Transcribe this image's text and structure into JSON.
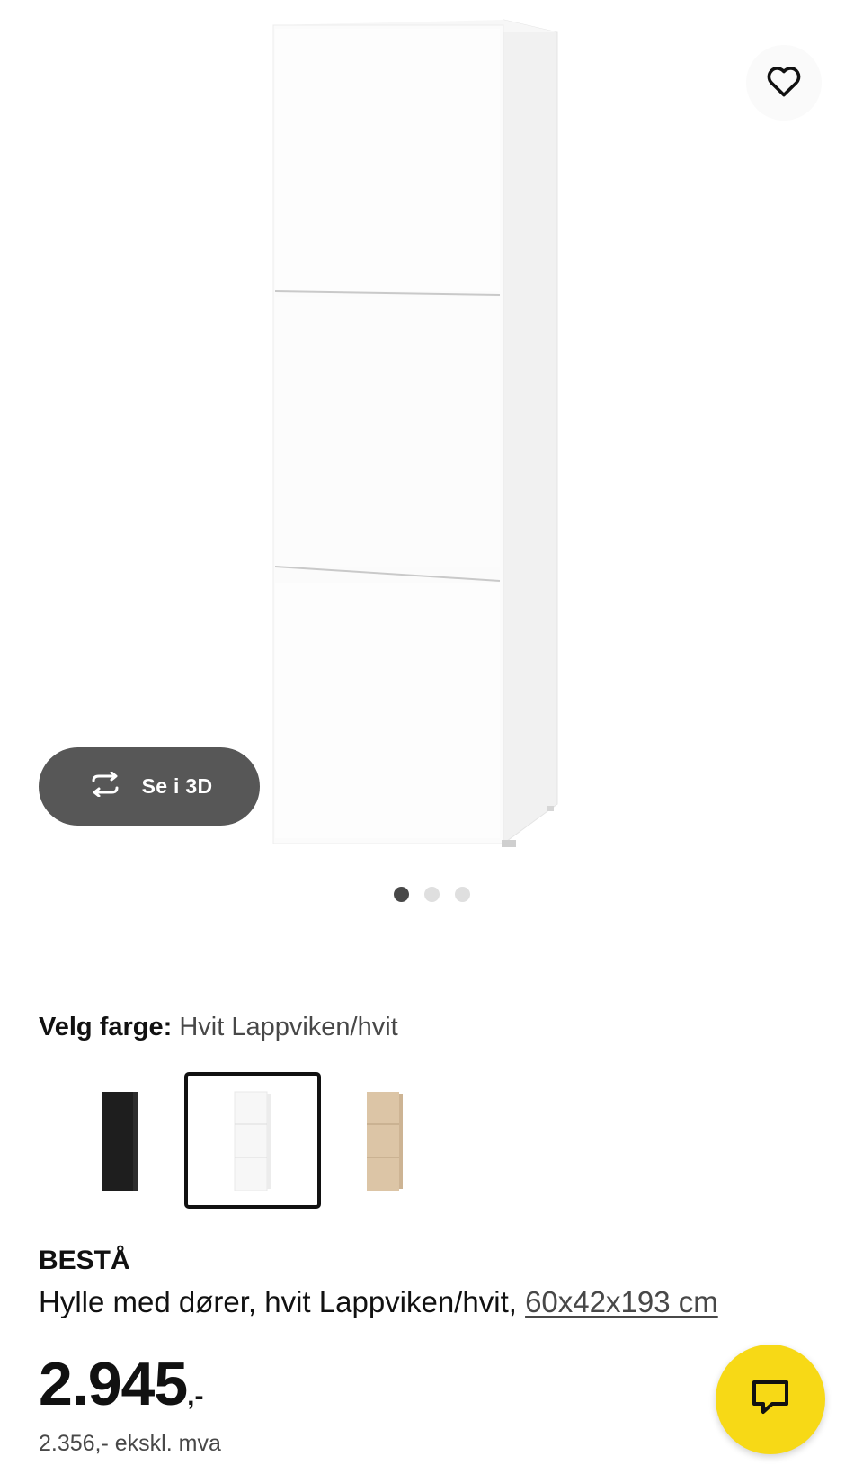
{
  "favorite": {
    "icon": "heart-icon"
  },
  "view_3d": {
    "label": "Se i 3D",
    "icon": "rotate-3d-icon"
  },
  "carousel": {
    "count": 3,
    "active_index": 0
  },
  "color_picker": {
    "label": "Velg farge:",
    "selected_value": "Hvit Lappviken/hvit",
    "options": [
      {
        "name": "black",
        "color": "#1e1e1e",
        "selected": false
      },
      {
        "name": "white",
        "color": "#f4f4f4",
        "selected": true
      },
      {
        "name": "oak-effect",
        "color": "#d9c2a3",
        "selected": false
      }
    ]
  },
  "product": {
    "name": "BESTÅ",
    "description": "Hylle med dører, hvit Lappviken/hvit, ",
    "dimensions": "60x42x193 cm",
    "price": "2.945",
    "price_suffix": ",-",
    "price_excl_vat": "2.356,- ekskl. mva"
  },
  "chat": {
    "icon": "chat-icon",
    "color": "#f7d916"
  }
}
